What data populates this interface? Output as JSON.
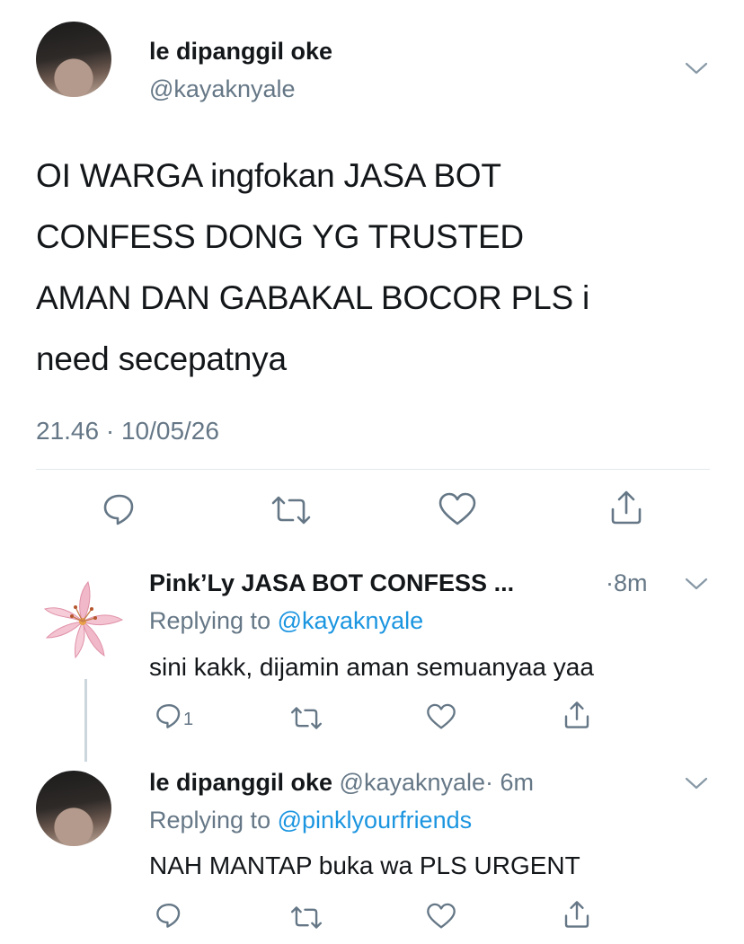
{
  "main_tweet": {
    "display_name": "le dipanggil oke",
    "handle": "@kayaknyale",
    "text_lines": [
      "OI WARGA ingfokan JASA BOT",
      "CONFESS DONG YG TRUSTED",
      "AMAN DAN GABAKAL BOCOR PLS i",
      "need secepatnya"
    ],
    "timestamp": "21.46 · 10/05/26"
  },
  "replies": [
    {
      "display_name": "Pink’Ly JASA BOT CONFESS ...",
      "time": "·8m",
      "replying_label": "Replying to",
      "replying_handle": "@kayaknyale",
      "text": "sini kakk, dijamin aman semuanyaa yaa",
      "reply_count": "1",
      "avatar_icon": "lily-flower"
    },
    {
      "display_name": "le dipanggil oke",
      "handle": "@kayaknyale",
      "time": "· 6m",
      "replying_label": "Replying to",
      "replying_handle": "@pinklyourfriends",
      "text": "NAH MANTAP buka wa PLS URGENT",
      "reply_count": ""
    }
  ],
  "icons": [
    "reply-icon",
    "retweet-icon",
    "like-icon",
    "share-icon",
    "chevron-down-icon"
  ],
  "colors": {
    "text": "#14171a",
    "secondary": "#657786",
    "link": "#1b95e0",
    "icon": "#657786",
    "divider": "#e1e8ed"
  }
}
